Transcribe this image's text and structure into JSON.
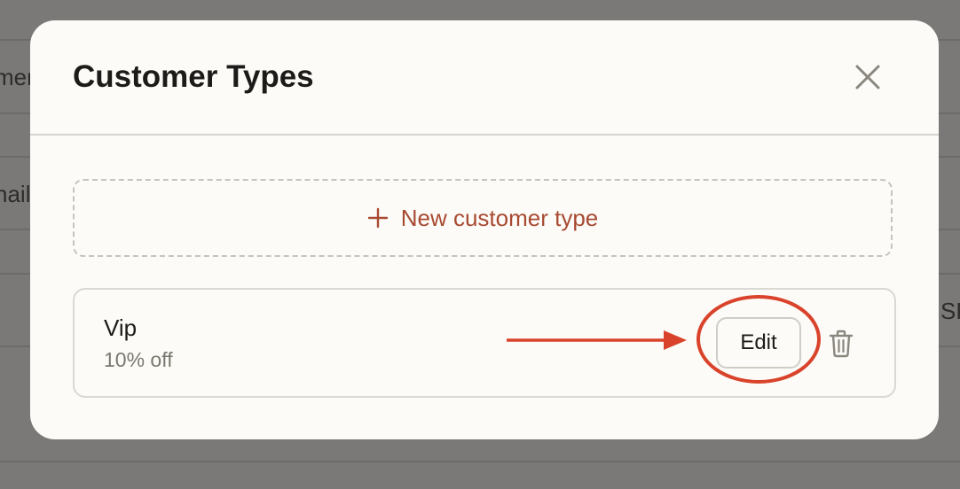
{
  "background": {
    "fragments": [
      "mer",
      "nail",
      "SF"
    ]
  },
  "modal": {
    "title": "Customer Types",
    "close_icon": "close-icon",
    "new_button_label": "New customer type",
    "new_button_icon": "plus-icon"
  },
  "customer_types": [
    {
      "name": "Vip",
      "description": "10% off",
      "edit_label": "Edit",
      "delete_icon": "trash-icon"
    }
  ],
  "annotation": {
    "type": "arrow-and-circle",
    "target": "edit-button",
    "color": "#d9432b"
  },
  "colors": {
    "accent": "#a84a32",
    "modal_bg": "#fcfbf7",
    "overlay": "#7b7977",
    "annotation": "#d9432b"
  }
}
